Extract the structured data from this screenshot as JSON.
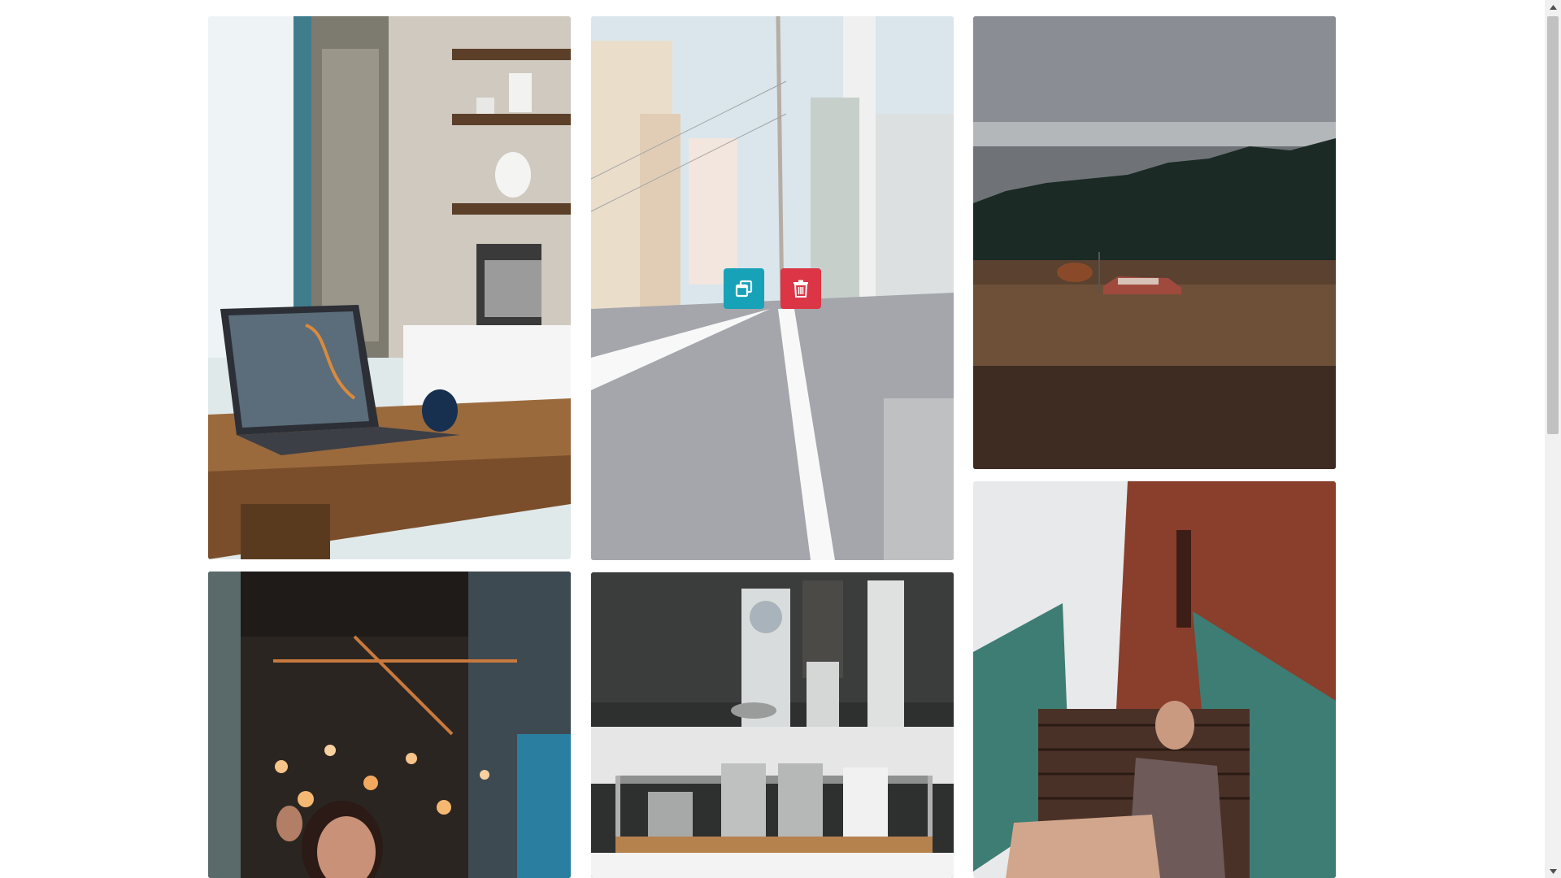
{
  "gallery": {
    "photos": [
      {
        "subject": "laptop-on-wooden-table"
      },
      {
        "subject": "japanese-street",
        "hovered": true
      },
      {
        "subject": "forest-field-red-car"
      },
      {
        "subject": "woman-in-bar-lights"
      },
      {
        "subject": "coffee-bar-equipment"
      },
      {
        "subject": "woman-on-stairs"
      }
    ],
    "overlay_buttons": {
      "view": {
        "icon": "clone-icon",
        "color": "#17a2b8"
      },
      "delete": {
        "icon": "trash-icon",
        "color": "#dc3545"
      }
    }
  },
  "colors": {
    "page_background": "#ffffff",
    "view_button": "#17a2b8",
    "delete_button": "#dc3545"
  }
}
